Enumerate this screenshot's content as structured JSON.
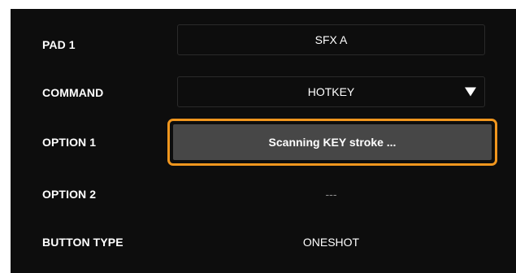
{
  "rows": [
    {
      "label": "PAD 1",
      "value": "SFX A"
    },
    {
      "label": "COMMAND",
      "value": "HOTKEY"
    },
    {
      "label": "OPTION 1",
      "value": "Scanning KEY stroke ..."
    },
    {
      "label": "OPTION 2",
      "value": "---"
    },
    {
      "label": "BUTTON TYPE",
      "value": "ONESHOT"
    }
  ],
  "colors": {
    "panel_bg": "#0d0d0d",
    "highlight": "#f0961e",
    "scan_bg": "#474747"
  },
  "icons": {
    "dropdown": "triangle-down-icon"
  }
}
